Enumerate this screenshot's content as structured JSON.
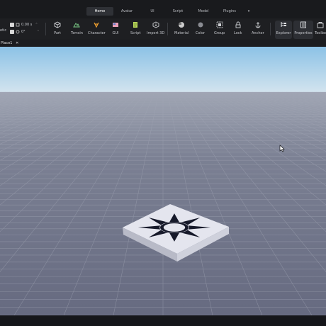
{
  "menu": {
    "tabs": [
      "Home",
      "Avatar",
      "UI",
      "Script",
      "Model",
      "Plugins"
    ],
    "more": "▾"
  },
  "toolbar": {
    "partial_label": "etic",
    "stud_value": "0.00 s",
    "degree_value": "0°",
    "tools": [
      {
        "label": "Part",
        "icon": "part-icon"
      },
      {
        "label": "Terrain",
        "icon": "terrain-icon"
      },
      {
        "label": "Character",
        "icon": "character-icon"
      },
      {
        "label": "GUI",
        "icon": "gui-icon"
      },
      {
        "label": "Script",
        "icon": "script-icon"
      },
      {
        "label": "Import 3D",
        "icon": "import-3d-icon"
      },
      {
        "label": "Material",
        "icon": "material-icon"
      },
      {
        "label": "Color",
        "icon": "color-icon"
      },
      {
        "label": "Group",
        "icon": "group-icon"
      },
      {
        "label": "Lock",
        "icon": "lock-icon"
      },
      {
        "label": "Anchor",
        "icon": "anchor-icon"
      },
      {
        "label": "Explorer",
        "icon": "explorer-icon"
      },
      {
        "label": "Properties",
        "icon": "properties-icon"
      },
      {
        "label": "Toolbo",
        "icon": "toolbox-icon"
      }
    ]
  },
  "document_tab": {
    "label": "Place1",
    "close": "✕"
  },
  "colors": {
    "sky_top": "#8cc2e6",
    "sky_bottom": "#d7e6ef",
    "ground": "#6e7287",
    "grid": "#9195a6",
    "tile": "#e2e3ec",
    "decal": "#16192a"
  }
}
